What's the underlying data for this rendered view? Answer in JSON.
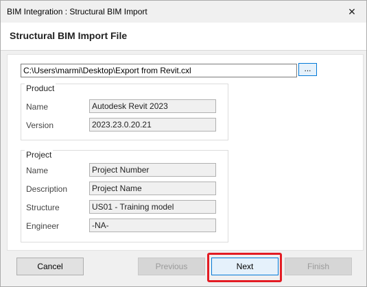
{
  "window": {
    "title": "BIM Integration : Structural BIM Import",
    "close_label": "✕"
  },
  "header": {
    "title": "Structural BIM Import File"
  },
  "file": {
    "path": "C:\\Users\\marmi\\Desktop\\Export from Revit.cxl",
    "browse_label": "..."
  },
  "product": {
    "legend": "Product",
    "fields": [
      {
        "label": "Name",
        "value": "Autodesk Revit 2023"
      },
      {
        "label": "Version",
        "value": "2023.23.0.20.21"
      }
    ]
  },
  "project": {
    "legend": "Project",
    "fields": [
      {
        "label": "Name",
        "value": "Project Number"
      },
      {
        "label": "Description",
        "value": "Project Name"
      },
      {
        "label": "Structure",
        "value": "US01 - Training model"
      },
      {
        "label": "Engineer",
        "value": "-NA-"
      }
    ]
  },
  "footer": {
    "cancel": "Cancel",
    "previous": "Previous",
    "next": "Next",
    "finish": "Finish"
  },
  "colors": {
    "highlight": "#e31b23",
    "accent": "#0078d7"
  }
}
